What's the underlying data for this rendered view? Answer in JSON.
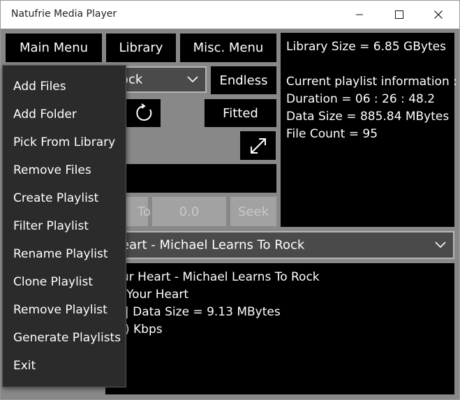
{
  "window": {
    "title": "Natufrie Media Player"
  },
  "toolbar": {
    "main_menu": "Main Menu",
    "library": "Library",
    "misc_menu": "Misc. Menu"
  },
  "playlist_select": {
    "value": "ock"
  },
  "mode": {
    "endless": "Endless",
    "fitted": "Fitted"
  },
  "seek": {
    "to_label": "To",
    "position": "0.0",
    "seek_label": "Seek"
  },
  "info": {
    "library_size": "Library Size = 6.85 GBytes",
    "heading": "Current playlist information :",
    "duration": "Duration = 06 : 26 : 48.2",
    "data_size": "Data Size = 885.84 MBytes",
    "file_count": "File Count = 95"
  },
  "track_select": {
    "value": "eart - Michael Learns To Rock"
  },
  "track_info": {
    "line1": "ur Heart - Michael Learns To Rock",
    "line2": "Your Heart",
    "line3": "| Data Size = 9.13 MBytes",
    "line4": ") Kbps"
  },
  "main_menu_items": [
    "Add Files",
    "Add Folder",
    "Pick From Library",
    "Remove Files",
    "Create Playlist",
    "Filter Playlist",
    "Rename Playlist",
    "Clone Playlist",
    "Remove Playlist",
    "Generate Playlists",
    "Exit"
  ],
  "icons": {
    "refresh": "refresh-icon",
    "expand": "expand-icon",
    "chevron": "chevron-down-icon"
  }
}
